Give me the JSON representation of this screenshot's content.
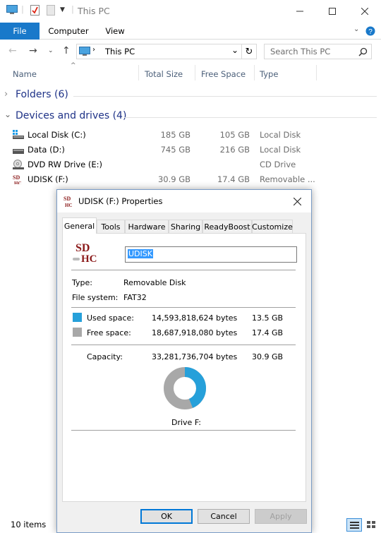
{
  "window": {
    "title": "This PC"
  },
  "ribbon": {
    "tabs": [
      "File",
      "Computer",
      "View"
    ]
  },
  "address": {
    "path": "This PC"
  },
  "search": {
    "placeholder": "Search This PC"
  },
  "columns": {
    "name": "Name",
    "total_size": "Total Size",
    "free_space": "Free Space",
    "type": "Type"
  },
  "groups": {
    "folders": "Folders (6)",
    "devices": "Devices and drives (4)"
  },
  "drives": [
    {
      "name": "Local Disk (C:)",
      "total": "185 GB",
      "free": "105 GB",
      "type": "Local Disk",
      "icon": "hard-drive-windows-icon"
    },
    {
      "name": "Data (D:)",
      "total": "745 GB",
      "free": "216 GB",
      "type": "Local Disk",
      "icon": "hard-drive-icon"
    },
    {
      "name": "DVD RW Drive (E:)",
      "total": "",
      "free": "",
      "type": "CD Drive",
      "icon": "dvd-drive-icon"
    },
    {
      "name": "UDISK (F:)",
      "total": "30.9 GB",
      "free": "17.4 GB",
      "type": "Removable ...",
      "icon": "sdhc-card-icon"
    }
  ],
  "status": {
    "items": "10 items"
  },
  "dialog": {
    "title": "UDISK (F:) Properties",
    "tabs": [
      "General",
      "Tools",
      "Hardware",
      "Sharing",
      "ReadyBoost",
      "Customize"
    ],
    "icon_text": {
      "top": "SD",
      "bottom": "HC"
    },
    "label_value": "UDISK",
    "type_label": "Type:",
    "type_value": "Removable Disk",
    "fs_label": "File system:",
    "fs_value": "FAT32",
    "used_label": "Used space:",
    "used_bytes": "14,593,818,624 bytes",
    "used_gb": "13.5 GB",
    "free_label": "Free space:",
    "free_bytes": "18,687,918,080 bytes",
    "free_gb": "17.4 GB",
    "cap_label": "Capacity:",
    "cap_bytes": "33,281,736,704 bytes",
    "cap_gb": "30.9 GB",
    "drive_label": "Drive F:",
    "buttons": {
      "ok": "OK",
      "cancel": "Cancel",
      "apply": "Apply"
    },
    "used_color": "#26a0da",
    "free_color": "#a8a8a8",
    "used_fraction": 0.4385
  }
}
